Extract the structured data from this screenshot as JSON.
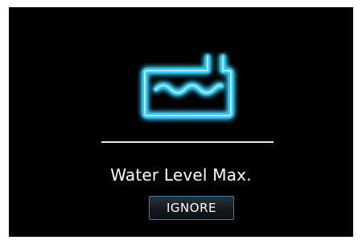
{
  "alert": {
    "icon": "water-tank-icon",
    "message": "Water Level Max.",
    "ignore_label": "IGNORE"
  },
  "colors": {
    "screen_background": "#000000",
    "icon_glow": "#39c6f2",
    "text": "#ffffff",
    "divider": "#e8e8e8",
    "button_border": "#3b7fa0"
  }
}
